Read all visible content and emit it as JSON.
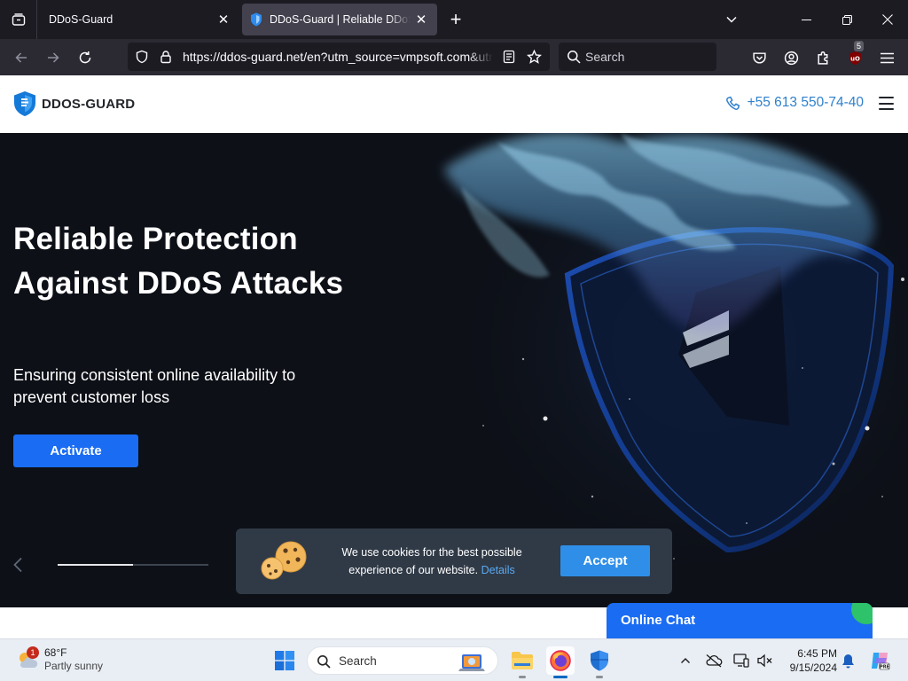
{
  "browser": {
    "tabs": [
      {
        "title": "DDoS-Guard",
        "active": false
      },
      {
        "title": "DDoS-Guard | Reliable DDoS Protection",
        "active": true
      }
    ],
    "url": "https://ddos-guard.net/en?utm_source=vmpsoft.com&utm_medium=referral",
    "search_placeholder": "Search",
    "extension_badge": "5"
  },
  "site": {
    "logo_text": "DDOS-GUARD",
    "phone": "+55 613 550-74-40",
    "hero": {
      "title": "Reliable Protection Against DDoS Attacks",
      "subtitle": "Ensuring consistent online availability to prevent customer loss",
      "cta_label": "Activate",
      "slider_progress": 0.5
    },
    "cookie": {
      "text": "We use cookies for the best possible experience of our website.",
      "details_label": "Details",
      "accept_label": "Accept"
    },
    "chat_label": "Online Chat"
  },
  "taskbar": {
    "weather_temp": "68°F",
    "weather_desc": "Partly sunny",
    "weather_badge": "1",
    "search_label": "Search",
    "time": "6:45 PM",
    "date": "9/15/2024"
  },
  "colors": {
    "accent": "#1a6cf2",
    "phone": "#2f80cd",
    "hero_bg": "#0d1017",
    "cookie_bg": "#303a47"
  }
}
